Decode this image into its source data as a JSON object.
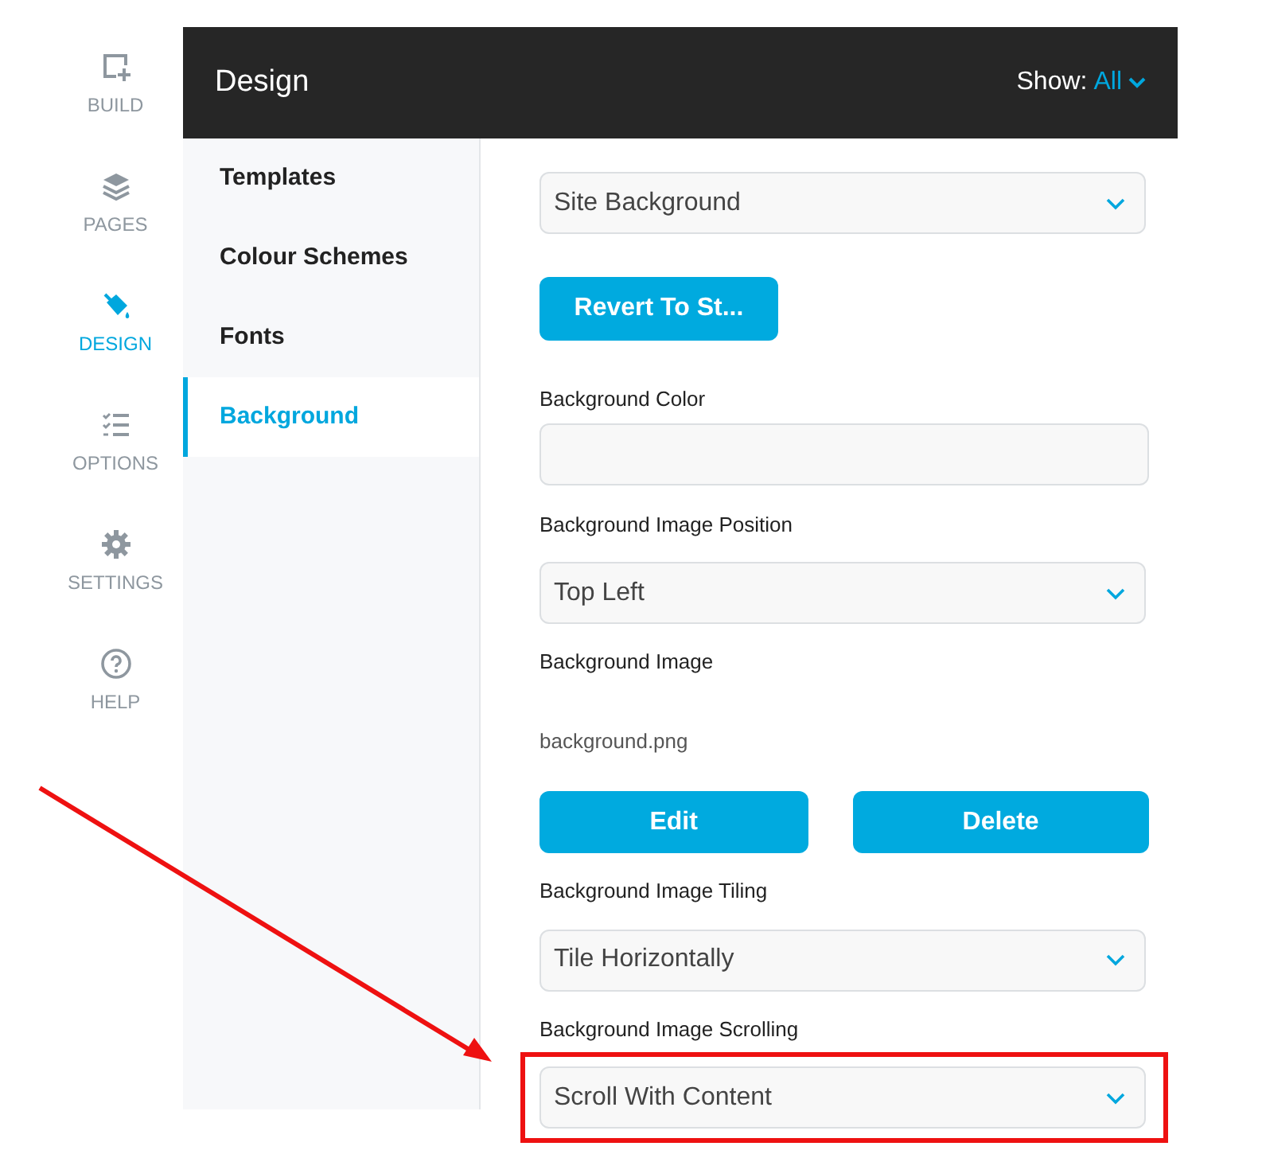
{
  "rail": [
    {
      "label": "BUILD",
      "selected": false
    },
    {
      "label": "PAGES",
      "selected": false
    },
    {
      "label": "DESIGN",
      "selected": true
    },
    {
      "label": "OPTIONS",
      "selected": false
    },
    {
      "label": "SETTINGS",
      "selected": false
    },
    {
      "label": "HELP",
      "selected": false
    }
  ],
  "header": {
    "title": "Design",
    "show_label": "Show:",
    "show_value": "All"
  },
  "menu": [
    {
      "label": "Templates",
      "selected": false
    },
    {
      "label": "Colour Schemes",
      "selected": false
    },
    {
      "label": "Fonts",
      "selected": false
    },
    {
      "label": "Background",
      "selected": true
    }
  ],
  "form": [
    {
      "kind": "select",
      "value": "Site Background",
      "highlighted": false
    },
    {
      "kind": "button",
      "label": "Revert To St..."
    },
    {
      "kind": "label",
      "text": "Background Color"
    },
    {
      "kind": "input"
    },
    {
      "kind": "label",
      "text": "Background Image Position"
    },
    {
      "kind": "select",
      "value": "Top Left",
      "highlighted": false
    },
    {
      "kind": "label",
      "text": "Background Image"
    },
    {
      "kind": "filename",
      "text": "background.png"
    },
    {
      "kind": "buttons",
      "labels": [
        "Edit",
        "Delete"
      ]
    },
    {
      "kind": "label",
      "text": "Background Image Tiling"
    },
    {
      "kind": "select",
      "value": "Tile Horizontally",
      "highlighted": false
    },
    {
      "kind": "label",
      "text": "Background Image Scrolling"
    },
    {
      "kind": "select",
      "value": "Scroll With Content",
      "highlighted": true
    }
  ]
}
